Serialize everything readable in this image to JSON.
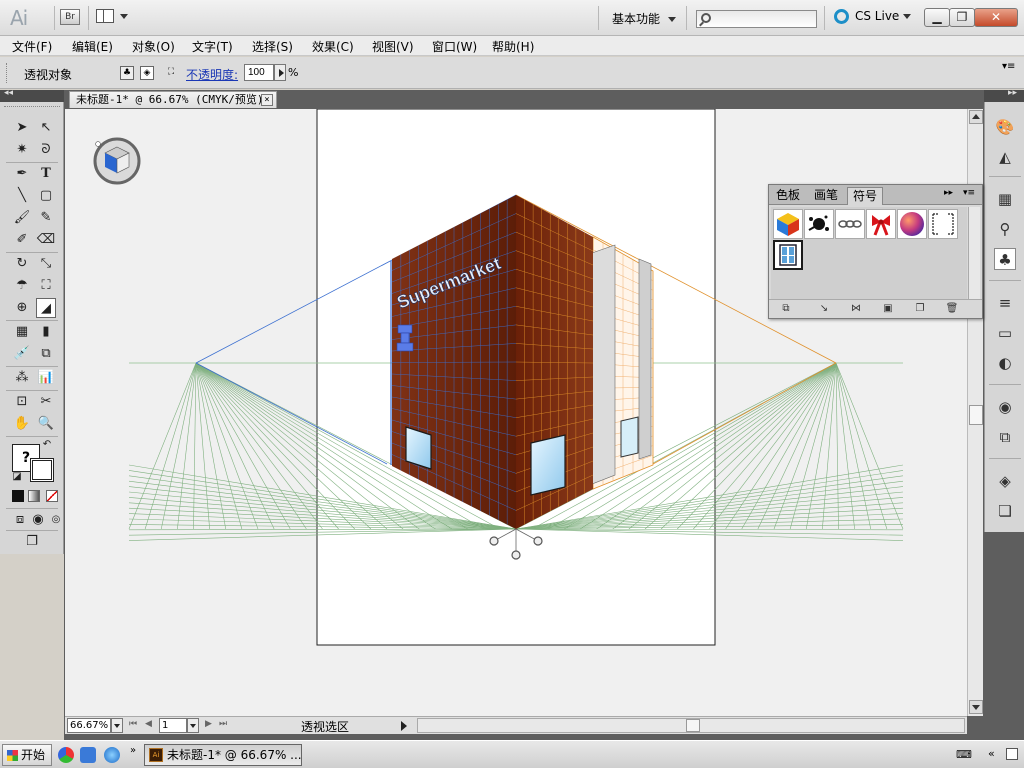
{
  "titlebar": {
    "app_logo": "Ai",
    "bridge_label": "Br",
    "workspace": "基本功能",
    "search_placeholder": "",
    "cslive": "CS Live",
    "min_glyph": "▁",
    "max_glyph": "❐",
    "close_glyph": "✕"
  },
  "menubar": {
    "items": [
      "文件(F)",
      "编辑(E)",
      "对象(O)",
      "文字(T)",
      "选择(S)",
      "效果(C)",
      "视图(V)",
      "窗口(W)",
      "帮助(H)"
    ]
  },
  "controlbar": {
    "label": "透视对象",
    "opacity_label": "不透明度:",
    "opacity_value": "100",
    "opacity_unit": "%",
    "menu_glyph": "▾≡"
  },
  "toolpanel": {
    "collapse_glyph": "◂◂",
    "help_glyph": "?"
  },
  "document": {
    "tab_title": "未标题-1* @ 66.67% (CMYK/预览)",
    "tab_close": "×",
    "artwork_text": "Supermarket"
  },
  "statusbar": {
    "zoom": "66.67%",
    "page": "1",
    "status_text": "透视选区"
  },
  "dock": {
    "collapse_glyph": "▸▸"
  },
  "symbols_panel": {
    "tabs": [
      "色板",
      "画笔",
      "符号"
    ],
    "active_tab": "符号",
    "collapse_glyph": "▸▸",
    "menu_glyph": "▾≡",
    "symbols": [
      "rubik-cube-symbol",
      "ink-splat-symbol",
      "chain-symbol",
      "ribbon-bow-symbol",
      "sphere-symbol",
      "grunge-frame-symbol",
      "window-symbol"
    ]
  },
  "taskbar": {
    "start": "开始",
    "ql_more": "»",
    "task_app_logo": "Ai",
    "task_item": "未标题-1* @ 66.67% ...",
    "tray_arrows": "«"
  },
  "colors": {
    "facade": "#7a2b12",
    "grid_left": "#3b6fd0",
    "grid_right": "#e0902a",
    "ground_grid": "#7fb07f",
    "close_red": "#c44a2a"
  }
}
